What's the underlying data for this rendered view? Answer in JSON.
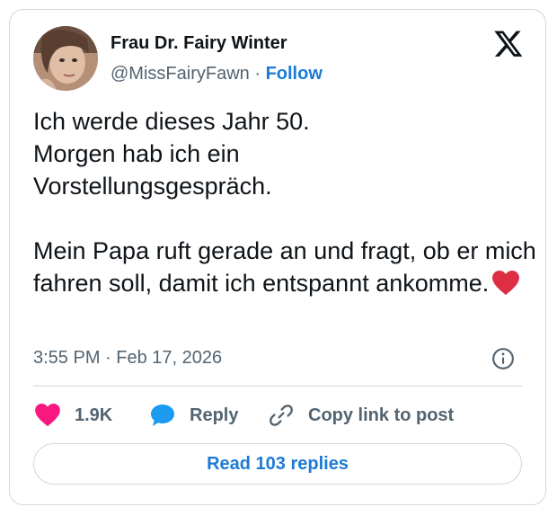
{
  "author": {
    "name": "Frau Dr. Fairy Winter",
    "handle": "@MissFairyFawn",
    "separator": "·",
    "follow_label": "Follow"
  },
  "tweet": {
    "lines_para1": [
      "Ich werde dieses Jahr 50.",
      "Morgen hab ich ein",
      "Vorstellungsgespräch."
    ],
    "para2": "Mein Papa ruft gerade an und fragt, ob er mich fahren soll, damit ich entspannt ankomme.",
    "timestamp": "3:55 PM · Feb 17, 2026"
  },
  "actions": {
    "like_count": "1.9K",
    "reply_label": "Reply",
    "copy_label": "Copy link to post"
  },
  "read_replies_label": "Read 103 replies",
  "colors": {
    "accent": "#1d7ad6",
    "like": "#f91880",
    "reply": "#1d9bf0",
    "muted": "#536471",
    "text": "#0f1419",
    "border": "#cfd9de"
  },
  "icons": [
    "x-logo-icon",
    "info-icon",
    "heart-icon",
    "speech-bubble-icon",
    "link-icon",
    "red-heart-emoji"
  ]
}
